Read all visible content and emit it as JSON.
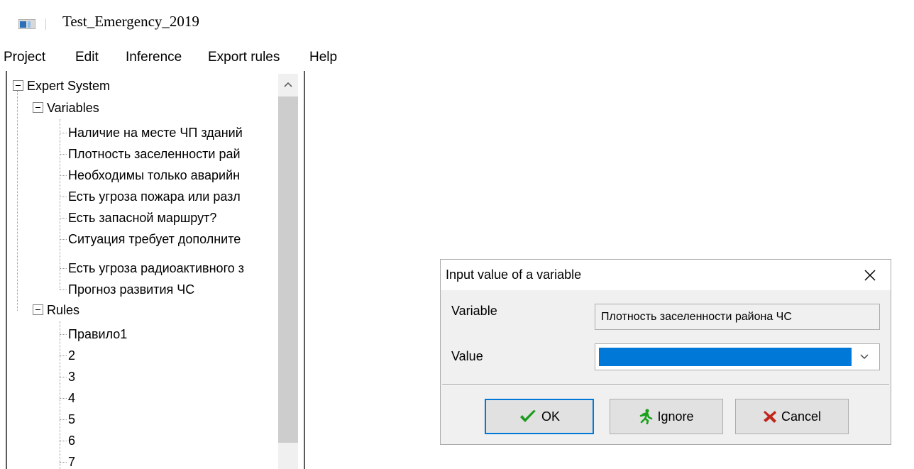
{
  "window": {
    "title": "Test_Emergency_2019"
  },
  "menu": [
    "Project",
    "Edit",
    "Inference",
    "Export rules",
    "Help"
  ],
  "tree": {
    "root": "Expert System",
    "variables_label": "Variables",
    "variables": [
      "Наличие на месте ЧП зданий",
      "Плотность заселенности рай",
      "Необходимы только аварийн",
      "Есть угроза пожара или разл",
      "Есть запасной маршрут?",
      "Ситуация требует дополните",
      "Есть угроза радиоактивного з",
      "Прогноз развития ЧС"
    ],
    "rules_label": "Rules",
    "rules": [
      "Правило1",
      "2",
      "3",
      "4",
      "5",
      "6",
      "7"
    ]
  },
  "dialog": {
    "title": "Input value of a variable",
    "variable_label": "Variable",
    "variable_value": "Плотность заселенности района ЧС",
    "value_label": "Value",
    "value_selected": "",
    "ok_label": "OK",
    "ignore_label": "Ignore",
    "cancel_label": "Cancel"
  },
  "colors": {
    "selection": "#0078d7",
    "ok_check": "#1a9a1a",
    "ignore_icon": "#1aa01a",
    "cancel_x": "#c0261b"
  },
  "icons": [
    "app-icon",
    "chevron-up-icon",
    "close-icon",
    "chevron-down-icon",
    "checkmark-icon",
    "running-man-icon",
    "x-icon"
  ]
}
